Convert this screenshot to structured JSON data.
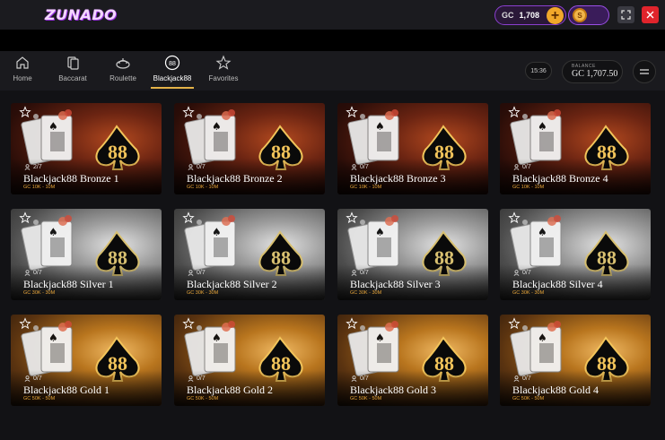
{
  "header": {
    "logo": "ZUNADO",
    "currency_label": "GC",
    "currency_amount": "1,708",
    "sc_coin_symbol": "S"
  },
  "nav": {
    "items": [
      {
        "label": "Home",
        "icon": "home-icon"
      },
      {
        "label": "Baccarat",
        "icon": "cards-icon"
      },
      {
        "label": "Roulette",
        "icon": "roulette-icon"
      },
      {
        "label": "Blackjack88",
        "icon": "blackjack88-icon",
        "active": true
      },
      {
        "label": "Favorites",
        "icon": "star-icon"
      }
    ],
    "time": "15:36",
    "balance_label": "BALANCE",
    "balance_value": "GC 1,707.50"
  },
  "tables": [
    {
      "name": "Blackjack88 Bronze 1",
      "players": "2/7",
      "limits": "GC 10K - 10M",
      "tier": "bronze"
    },
    {
      "name": "Blackjack88 Bronze 2",
      "players": "0/7",
      "limits": "GC 10K - 10M",
      "tier": "bronze"
    },
    {
      "name": "Blackjack88 Bronze 3",
      "players": "0/7",
      "limits": "GC 10K - 10M",
      "tier": "bronze"
    },
    {
      "name": "Blackjack88 Bronze 4",
      "players": "0/7",
      "limits": "GC 10K - 10M",
      "tier": "bronze"
    },
    {
      "name": "Blackjack88 Silver 1",
      "players": "0/7",
      "limits": "GC 30K - 30M",
      "tier": "silver"
    },
    {
      "name": "Blackjack88 Silver 2",
      "players": "0/7",
      "limits": "GC 30K - 30M",
      "tier": "silver"
    },
    {
      "name": "Blackjack88 Silver 3",
      "players": "0/7",
      "limits": "GC 30K - 30M",
      "tier": "silver"
    },
    {
      "name": "Blackjack88 Silver 4",
      "players": "0/7",
      "limits": "GC 30K - 30M",
      "tier": "silver"
    },
    {
      "name": "Blackjack88 Gold 1",
      "players": "0/7",
      "limits": "GC 50K - 50M",
      "tier": "gold"
    },
    {
      "name": "Blackjack88 Gold 2",
      "players": "0/7",
      "limits": "GC 50K - 50M",
      "tier": "gold"
    },
    {
      "name": "Blackjack88 Gold 3",
      "players": "0/7",
      "limits": "GC 50K - 50M",
      "tier": "gold"
    },
    {
      "name": "Blackjack88 Gold 4",
      "players": "0/7",
      "limits": "GC 50K - 50M",
      "tier": "gold"
    }
  ],
  "colors": {
    "accent_gold": "#e4b248",
    "close_red": "#e0242c",
    "brand_purple": "#8b3fd0"
  }
}
